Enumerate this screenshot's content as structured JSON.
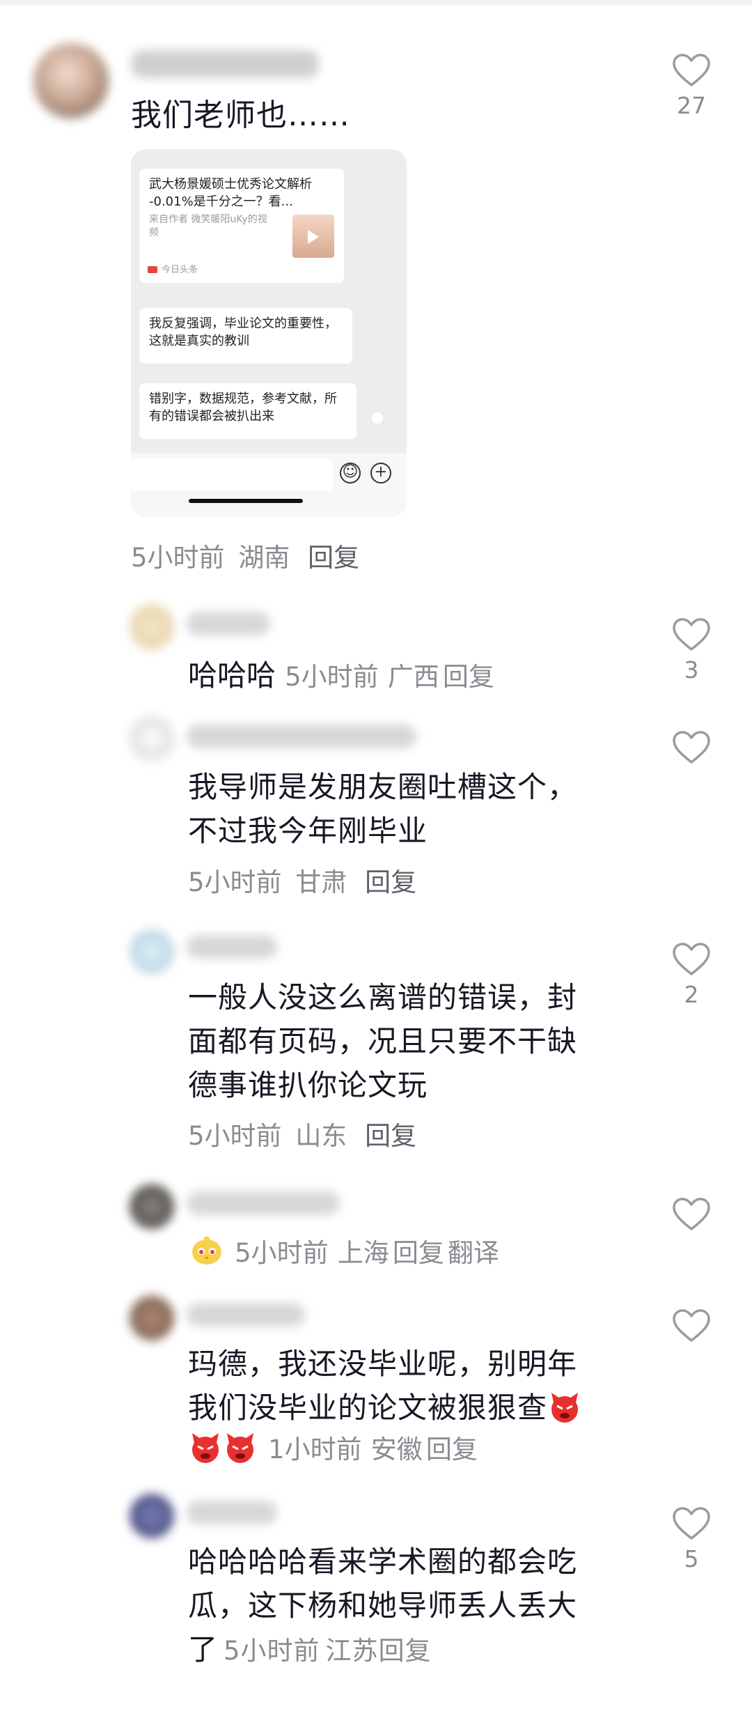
{
  "comments": [
    {
      "text": "我们老师也……",
      "image": {
        "card_title": "武大杨景媛硕士优秀论文解析 -0.01%是千分之一？看...",
        "card_author": "来自作者 微笑暖阳uKy的视频",
        "card_source": "今日头条",
        "msg1": "我反复强调，毕业论文的重要性，这就是真实的教训",
        "msg2": "错别字，数据规范，参考文献，所有的错误都会被扒出来"
      },
      "time": "5小时前",
      "location": "湖南",
      "reply": "回复",
      "likes": "27"
    }
  ],
  "replies": [
    {
      "text": "哈哈哈",
      "time": "5小时前",
      "location": "广西",
      "reply": "回复",
      "likes": "3"
    },
    {
      "line1": "我导师是发朋友圈吐槽这个，",
      "line2": "不过我今年刚毕业",
      "time": "5小时前",
      "location": "甘肃",
      "reply": "回复",
      "likes": ""
    },
    {
      "line1": "一般人没这么离谱的错误，封",
      "line2": "面都有页码，况且只要不干缺",
      "line3": "德事谁扒你论文玩",
      "time": "5小时前",
      "location": "山东",
      "reply": "回复",
      "likes": "2"
    },
    {
      "emoji": "🐣",
      "time": "5小时前",
      "location": "上海",
      "reply": "回复",
      "translate": "翻译",
      "likes": ""
    },
    {
      "line1": "玛德，我还没毕业呢，别明年",
      "line2": "我们没毕业的论文被狠狠查",
      "time": "1小时前",
      "location": "安徽",
      "reply": "回复",
      "likes": ""
    },
    {
      "line1": "哈哈哈哈看来学术圈的都会吃",
      "line2": "瓜，这下杨和她导师丢人丢大",
      "line3": "了",
      "time": "5小时前",
      "location": "江苏",
      "reply": "回复",
      "likes": "5"
    }
  ],
  "icons": {
    "like": "heart-outline-icon",
    "devil": "angry-devil-emoji"
  }
}
